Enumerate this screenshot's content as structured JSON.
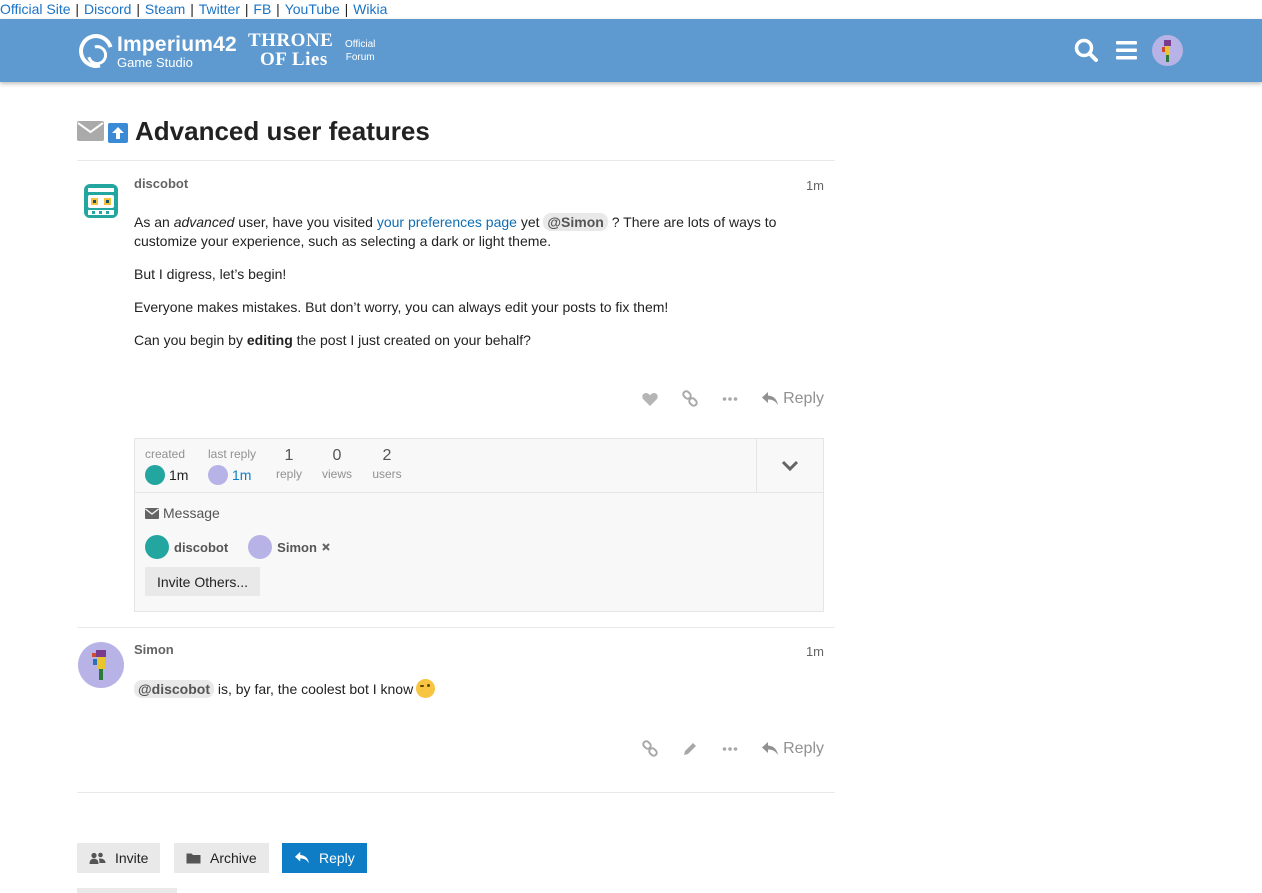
{
  "toplinks": [
    "Official Site",
    "Discord",
    "Steam",
    "Twitter",
    "FB",
    "YouTube",
    "Wikia"
  ],
  "header": {
    "studio_name": "Imperium42",
    "studio_sub": "Game Studio",
    "game_line1": "THRONE",
    "game_line2": "OF Lies",
    "official_line1": "Official",
    "official_line2": "Forum",
    "bg_color": "#5e9acf"
  },
  "topic": {
    "title": "Advanced user features"
  },
  "post1": {
    "username": "discobot",
    "date": "1m",
    "p1_a": "As an ",
    "p1_em": "advanced",
    "p1_b": " user, have you visited ",
    "p1_link": "your preferences page",
    "p1_c": " yet ",
    "p1_mention": "@Simon",
    "p1_d": " ? There are lots of ways to customize your experience, such as selecting a dark or light theme.",
    "p2": "But I digress, let’s begin!",
    "p3": "Everyone makes mistakes. But don’t worry, you can always edit your posts to fix them!",
    "p4_a": "Can you begin by ",
    "p4_strong": "editing",
    "p4_b": " the post I just created on your behalf?",
    "reply_label": "Reply"
  },
  "topic_map": {
    "created_label": "created",
    "created_value": "1m",
    "last_reply_label": "last reply",
    "last_reply_value": "1m",
    "replies_num": "1",
    "replies_label": "reply",
    "views_num": "0",
    "views_label": "views",
    "users_num": "2",
    "users_label": "users",
    "message_label": "Message",
    "participants": [
      "discobot",
      "Simon"
    ],
    "invite_label": "Invite Others..."
  },
  "post2": {
    "username": "Simon",
    "date": "1m",
    "mention": "@discobot",
    "text": " is, by far, the coolest bot I know",
    "reply_label": "Reply"
  },
  "footer": {
    "invite_label": "Invite",
    "archive_label": "Archive",
    "reply_label": "Reply",
    "primary_color": "#0e7dc6"
  },
  "icons": {
    "search": "search-icon",
    "menu": "hamburger-icon",
    "envelope": "envelope-icon",
    "upvote": "arrow-up-icon",
    "heart": "heart-icon",
    "link": "link-icon",
    "more": "ellipsis-icon",
    "reply": "reply-icon",
    "edit": "pencil-icon",
    "chevron": "chevron-down-icon"
  }
}
